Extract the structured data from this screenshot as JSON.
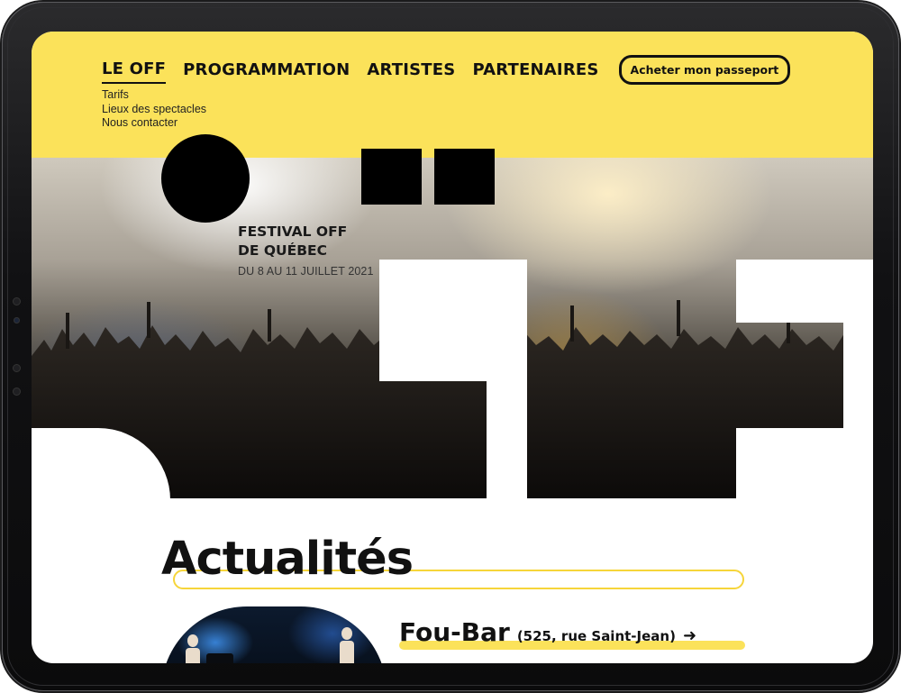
{
  "nav": {
    "items": [
      "LE OFF",
      "PROGRAMMATION",
      "ARTISTES",
      "PARTENAIRES"
    ],
    "active": "LE OFF",
    "cta_label": "Acheter mon passeport"
  },
  "subnav": {
    "items": [
      "Tarifs",
      "Lieux des spectacles",
      "Nous contacter"
    ]
  },
  "hero": {
    "festival_title": "FESTIVAL OFF\nDE QUÉBEC",
    "dates": "DU 8 AU 11 JUILLET 2021"
  },
  "news": {
    "title": "Actualités",
    "venue_name": "Fou-Bar",
    "venue_address": "(525, rue Saint-Jean)",
    "arrow": "➜"
  },
  "colors": {
    "brand_yellow": "#fbe25a",
    "ink": "#111111"
  }
}
